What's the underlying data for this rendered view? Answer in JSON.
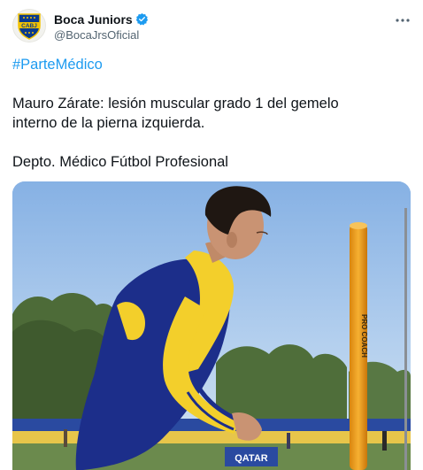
{
  "author": {
    "display_name": "Boca Juniors",
    "handle": "@BocaJrsOficial",
    "verified": true,
    "avatar_text": "CABJ",
    "avatar_colors": {
      "primary": "#0a3a8c",
      "accent": "#f4c300"
    }
  },
  "tweet": {
    "hashtag": "#ParteMédico",
    "line1": "Mauro Zárate: lesión muscular grado 1 del gemelo",
    "line2": "interno de la pierna izquierda.",
    "signature": "Depto. Médico Fútbol Profesional"
  },
  "photo": {
    "pole_text": "PRO COACH",
    "banner_text": "QATAR",
    "description_icons": [
      "more-icon",
      "verified-badge-icon"
    ]
  },
  "colors": {
    "link": "#1d9bf0",
    "text": "#0f1419",
    "muted": "#536471",
    "sky": "#a7c8ee",
    "shirt_blue": "#1c2e8a",
    "shirt_yellow": "#f3cf2b",
    "pole": "#f0a020"
  }
}
